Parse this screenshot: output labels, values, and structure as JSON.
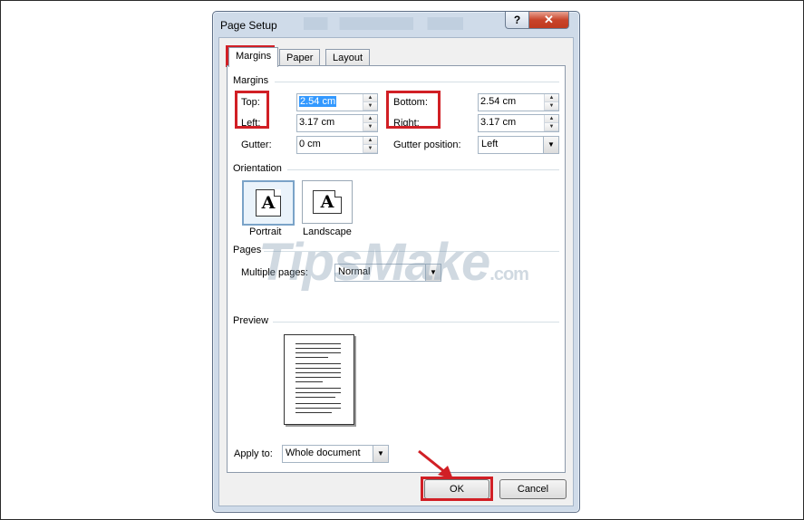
{
  "dialog": {
    "title": "Page Setup",
    "help_glyph": "?",
    "close_glyph": "✕"
  },
  "tabs": [
    "Margins",
    "Paper",
    "Layout"
  ],
  "margins": {
    "section_label": "Margins",
    "top": {
      "label": "Top:",
      "value": "2.54 cm"
    },
    "bottom": {
      "label": "Bottom:",
      "value": "2.54 cm"
    },
    "left": {
      "label": "Left:",
      "value": "3.17 cm"
    },
    "right": {
      "label": "Right:",
      "value": "3.17 cm"
    },
    "gutter": {
      "label": "Gutter:",
      "value": "0 cm"
    },
    "gutter_position": {
      "label": "Gutter position:",
      "value": "Left"
    }
  },
  "orientation": {
    "section_label": "Orientation",
    "portrait_label": "Portrait",
    "landscape_label": "Landscape",
    "icon_letter": "A"
  },
  "pages": {
    "section_label": "Pages",
    "multiple_pages_label": "Multiple pages:",
    "multiple_pages_value": "Normal"
  },
  "preview": {
    "section_label": "Preview"
  },
  "apply_to": {
    "label": "Apply to:",
    "value": "Whole document"
  },
  "buttons": {
    "ok": "OK",
    "cancel": "Cancel"
  },
  "watermark": {
    "text": "TipsMake",
    "domain": ".com"
  },
  "colors": {
    "highlight_box": "#d11f25",
    "selection": "#3399ff"
  }
}
